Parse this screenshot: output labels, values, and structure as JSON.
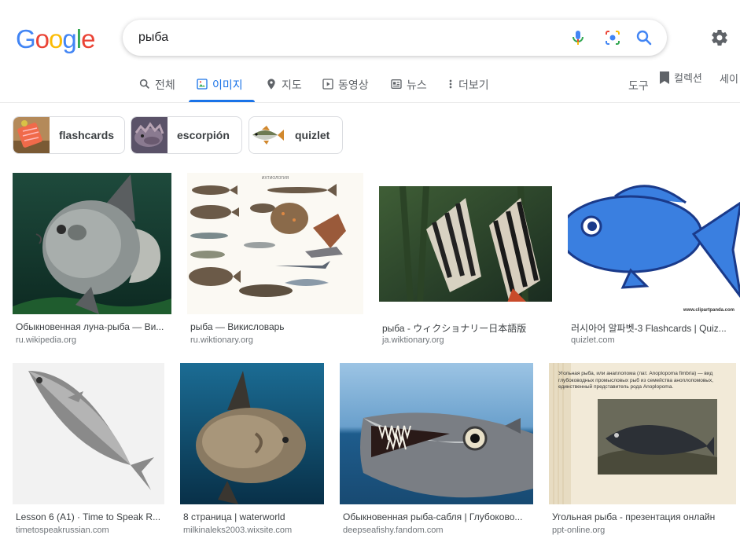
{
  "logo": "Google",
  "search": {
    "query": "рыба"
  },
  "tabs": [
    {
      "label": "전체",
      "icon": "search-icon"
    },
    {
      "label": "이미지",
      "icon": "image-icon",
      "active": true
    },
    {
      "label": "지도",
      "icon": "map-pin-icon"
    },
    {
      "label": "동영상",
      "icon": "play-icon"
    },
    {
      "label": "뉴스",
      "icon": "news-icon"
    },
    {
      "label": "더보기",
      "icon": "more-vert-icon"
    }
  ],
  "tools_label": "도구",
  "collections_label": "컬렉션",
  "safesearch_label": "세이",
  "chips": [
    {
      "label": "flashcards"
    },
    {
      "label": "escorpión"
    },
    {
      "label": "quizlet"
    }
  ],
  "results": [
    {
      "title": "Обыкновенная луна-рыба — Ви...",
      "source": "ru.wikipedia.org"
    },
    {
      "title": "рыба — Викисловарь",
      "source": "ru.wiktionary.org"
    },
    {
      "title": "рыба - ウィクショナリー日本語版",
      "source": "ja.wiktionary.org"
    },
    {
      "title": "러시아어 알파벳-3 Flashcards | Quiz...",
      "source": "quizlet.com"
    },
    {
      "title": "Lesson 6 (A1) · Time to Speak R...",
      "source": "timetospeakrussian.com"
    },
    {
      "title": "8 страница | waterworld",
      "source": "milkinaleks2003.wixsite.com"
    },
    {
      "title": "Обыкновенная рыба-сабля | Глубоково...",
      "source": "deepseafishy.fandom.com"
    },
    {
      "title": "Угольная рыба - презентация онлайн",
      "source": "ppt-online.org"
    }
  ],
  "image_captions": {
    "fish_chart_header": "ИХТИОЛОГИЯ",
    "clipart_watermark": "www.clipartpanda.com",
    "coalfish_text": "Угольная рыба, или анаплопома (лат. Anoplopoma fimbria) — вид глубоководных промысловых рыб из семейства аноплопомовых, единственный представитель рода Anoplopoma."
  },
  "colors": {
    "accent": "#1a73e8",
    "blue": "#4285F4",
    "red": "#EA4335",
    "yellow": "#FBBC05",
    "green": "#34A853"
  }
}
